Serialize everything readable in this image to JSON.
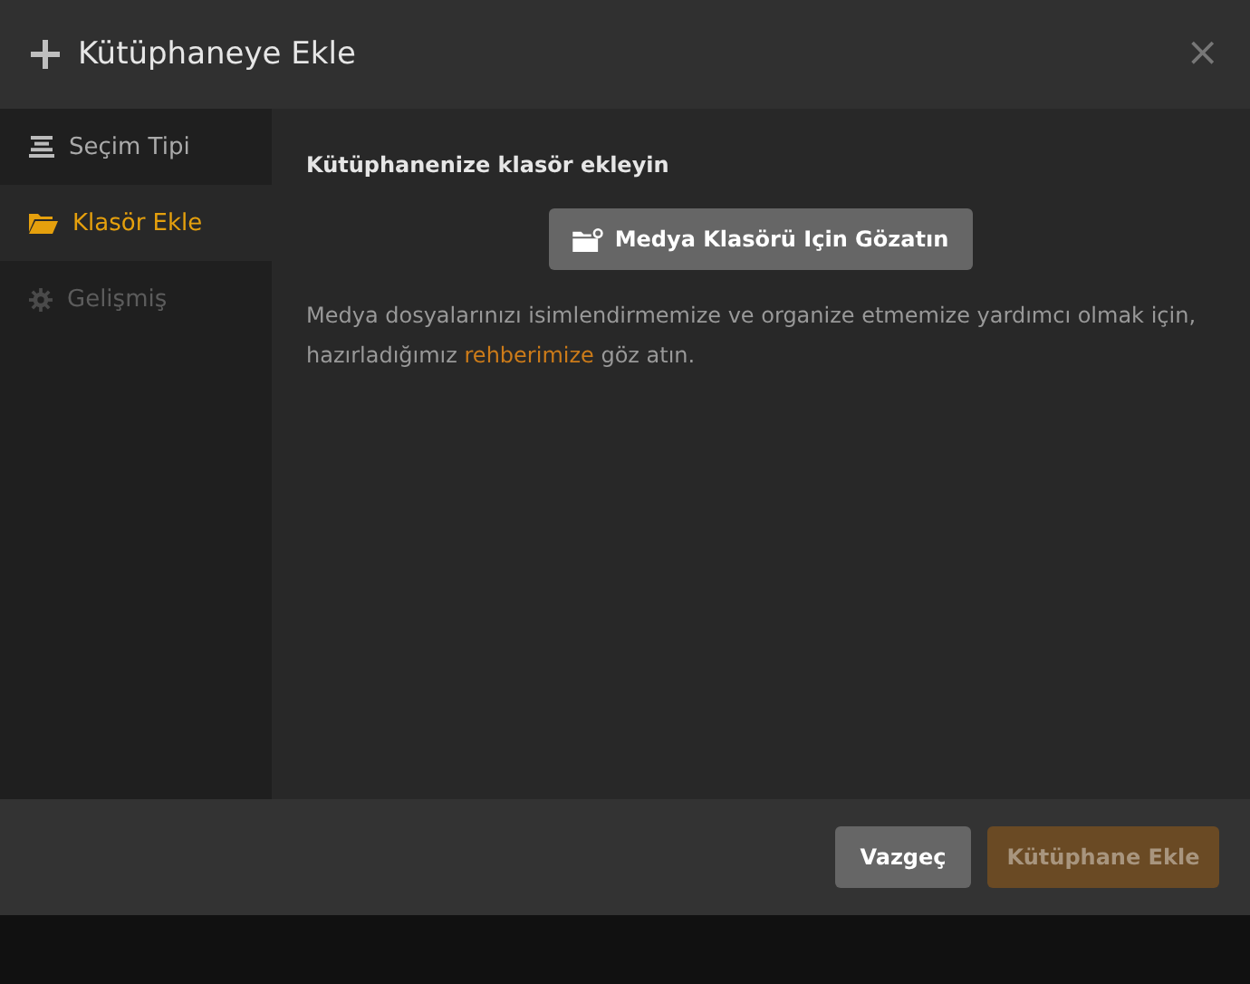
{
  "dialog": {
    "title": "Kütüphaneye Ekle",
    "close": "×"
  },
  "sidebar": {
    "items": [
      {
        "label": "Seçim Tipi",
        "selected": false,
        "disabled": false
      },
      {
        "label": "Klasör Ekle",
        "selected": true,
        "disabled": false
      },
      {
        "label": "Gelişmiş",
        "selected": false,
        "disabled": true
      }
    ]
  },
  "content": {
    "heading": "Kütüphanenize klasör ekleyin",
    "browse_button": "Medya Klasörü Için Gözatın",
    "description": {
      "before": "Medya dosyalarınızı isimlendirmemize ve organize etmemize yardımcı olmak için, hazırladığımız ",
      "link": "rehberimize",
      "after": " göz atın."
    }
  },
  "footer": {
    "buttons": [
      {
        "label": "Vazgeç",
        "kind": "cancel",
        "disabled": false
      },
      {
        "label": "Kütüphane Ekle",
        "kind": "primary",
        "disabled": true
      }
    ]
  }
}
